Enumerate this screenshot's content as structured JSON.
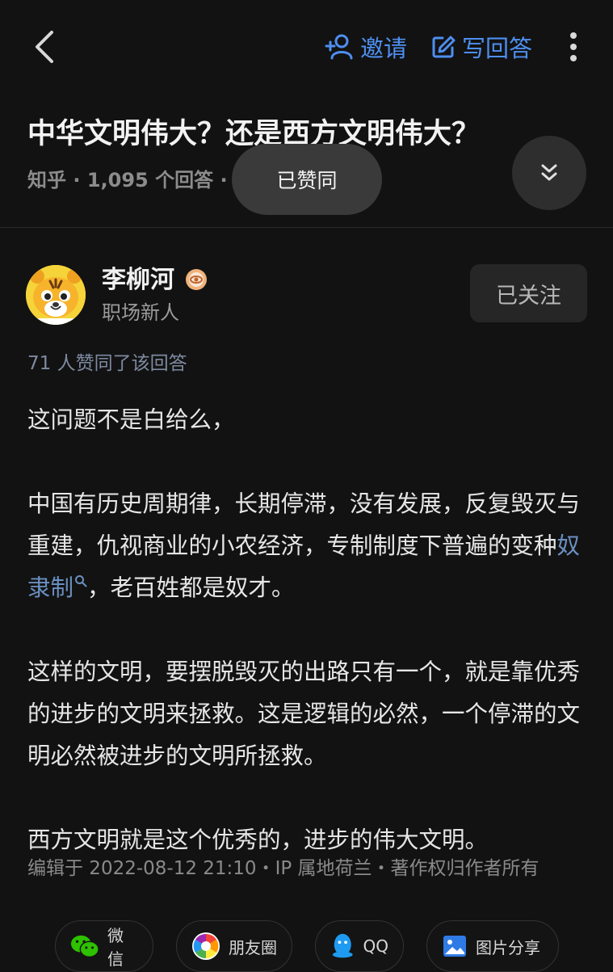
{
  "header": {
    "invite_label": "邀请",
    "write_answer_label": "写回答"
  },
  "question": {
    "title": "中华文明伟大？还是西方文明伟大？",
    "meta": "知乎 · 1,095 个回答 · 1"
  },
  "toast": {
    "text": "已赞同"
  },
  "author": {
    "name": "李柳河",
    "description": "职场新人",
    "follow_label": "已关注"
  },
  "answer": {
    "vote_count": "71 人赞同了该回答",
    "p1": "这问题不是白给么，",
    "p2_before": "中国有历史周期律，长期停滞，没有发展，反复毁灭与重建，仇视商业的小农经济，专制制度下普遍的变种",
    "p2_link": "奴隶制",
    "p2_after": "，老百姓都是奴才。",
    "p3": "这样的文明，要摆脱毁灭的出路只有一个，就是靠优秀的进步的文明来拯救。这是逻辑的必然，一个停滞的文明必然被进步的文明所拯救。",
    "p4": "西方文明就是这个优秀的，进步的伟大文明。",
    "edit_meta": "编辑于 2022-08-12 21:10・IP 属地荷兰・著作权归作者所有"
  },
  "share": {
    "wechat": "微信",
    "moments": "朋友圈",
    "qq": "QQ",
    "image_share": "图片分享"
  },
  "colors": {
    "background": "#121212",
    "accent_blue": "#4e8ff0",
    "link_blue": "#6a8fc0"
  }
}
